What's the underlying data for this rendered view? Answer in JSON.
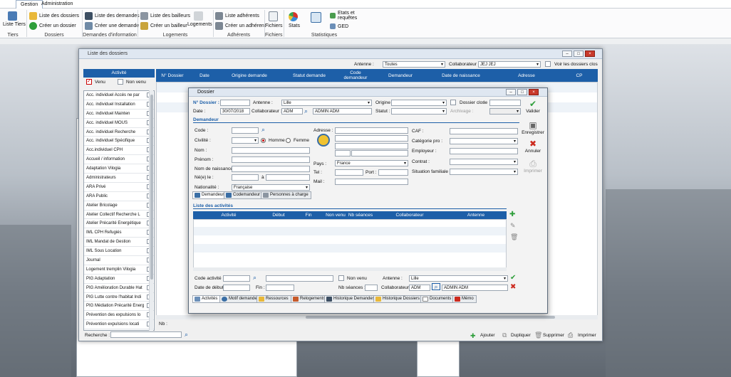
{
  "menu": {
    "tabs": [
      "Gestion",
      "Administration"
    ]
  },
  "ribbon": {
    "tiers": {
      "item": "Liste Tiers",
      "caption": "Tiers"
    },
    "dossiers": {
      "items": [
        "Liste des dossiers",
        "Créer un dossier"
      ],
      "caption": "Dossiers"
    },
    "demandes": {
      "items": [
        "Liste des demandes",
        "Créer une demande"
      ],
      "caption": "Demandes d'information"
    },
    "logements": {
      "items": [
        "Liste des bailleurs",
        "Créer un bailleur",
        "Logements"
      ],
      "caption": "Logements"
    },
    "adherents": {
      "items": [
        "Liste adhérents",
        "Créer un adhérent"
      ],
      "caption": "Adhérents"
    },
    "fichiers": {
      "item": "Fichiers",
      "caption": "Fichiers"
    },
    "stats": {
      "items": [
        "Stats",
        "Etats et requêtes",
        "GED"
      ],
      "caption": "Statistiques"
    }
  },
  "list_window": {
    "title": "Liste des dossiers",
    "antenne_label": "Antenne :",
    "antenne_value": "Toutes",
    "collab_label": "Collaborateur :",
    "collab_value": "JEJ JEJ",
    "closed_label": "Voir les dossiers clos",
    "activity_header": "Activité",
    "venu": "Venu",
    "non_venu": "Non venu",
    "activities": [
      "Acc. individuel Accès ne par",
      "Acc. individuel Installation",
      "Acc. individuel Mainten",
      "Acc. individuel MOUS",
      "Acc. individuel Recherche",
      "Acc. individuel Spécifique",
      "Acc.individuel CPH",
      "Accueil / information",
      "Adaptation Vilogia",
      "Administrateurs",
      "ARA Privé",
      "ARA Public",
      "Atelier Bricolage",
      "Atelier Collectif Recherche L",
      "Atelier Précarité Energétique",
      "IML CPH Refugiés",
      "IML Mandat de Gestion",
      "IML Sous Location",
      "Journal",
      "Logement tremplin Vilogia",
      "PIG Adaptation",
      "PIG Amélioration Durable Hat",
      "PIG Lutte contre l'habitat Indi",
      "PIG Médiation Précarité Energ",
      "Prévention des expulsions lo",
      "Prévention expulsions locati"
    ],
    "columns": [
      "N° Dossier",
      "Date",
      "Origine demande",
      "Statut demande",
      "Code demandeur",
      "Demandeur",
      "Date de naissance",
      "Adresse",
      "CP"
    ],
    "search_label": "Recherche :",
    "nb_label": "Nb :",
    "actions": [
      "Ajouter",
      "Dupliquer",
      "Supprimer",
      "Imprimer"
    ]
  },
  "dossier": {
    "title": "Dossier",
    "num_label": "N° Dossier :",
    "num_value": "",
    "date_label": "Date :",
    "date_value": "30/07/2018",
    "antenne_label": "Antenne :",
    "antenne_value": "Lille",
    "collab_label": "Collaborateur :",
    "collab_code": "ADM",
    "collab_name": "ADMIN ADM",
    "origine_label": "Origine :",
    "statut_label": "Statut :",
    "clos_label": "Dossier clos",
    "clos_le": "le",
    "archivage_label": "Archivage :",
    "side_actions": [
      "Valider",
      "Enregistrer",
      "Annuler",
      "Imprimer"
    ],
    "demandeur_section": "Demandeur",
    "code_label": "Code :",
    "civilite_label": "Civilité :",
    "homme": "Homme",
    "femme": "Femme",
    "nom_label": "Nom :",
    "prenom_label": "Prénom :",
    "nom_naissance_label": "Nom de naissance :",
    "ne_le_label": "Né(e) le :",
    "a_label": "à",
    "nationalite_label": "Nationalité :",
    "nationalite_value": "Française",
    "adresse_label": "Adresse :",
    "pays_label": "Pays :",
    "pays_value": "France",
    "tel_label": "Tel :",
    "port_label": "Port :",
    "mail_label": "Mail :",
    "caf_label": "CAF :",
    "cat_label": "Catégorie pro :",
    "employeur_label": "Employeur :",
    "contrat_label": "Contrat :",
    "situation_label": "Situation familiale :",
    "person_tabs": [
      "Demandeur",
      "Codemandeur",
      "Personnes à charge"
    ],
    "activities_section": "Liste des activités",
    "act_columns": [
      "Activité",
      "Début",
      "Fin",
      "Non venu",
      "Nb séances",
      "Collaborateur",
      "Antenne"
    ],
    "code_act_label": "Code activité :",
    "non_venu_label": "Non venu",
    "antenne2_label": "Antenne :",
    "antenne2_value": "Lille",
    "date_debut_label": "Date de début :",
    "fin_label": "Fin :",
    "nb_seances_label": "Nb séances :",
    "collab2_label": "Collaborateur :",
    "collab2_code": "ADM",
    "collab2_name": "ADMIN ADM",
    "bottom_tabs": [
      "Activités",
      "Motif demande",
      "Ressources",
      "Relogements",
      "Historique Demandes",
      "Historique Dossiers",
      "Documents",
      "Mémo"
    ]
  },
  "colors": {
    "accent": "#1d5fa8",
    "ok": "#2e9e3a",
    "danger": "#cc2a1e"
  }
}
